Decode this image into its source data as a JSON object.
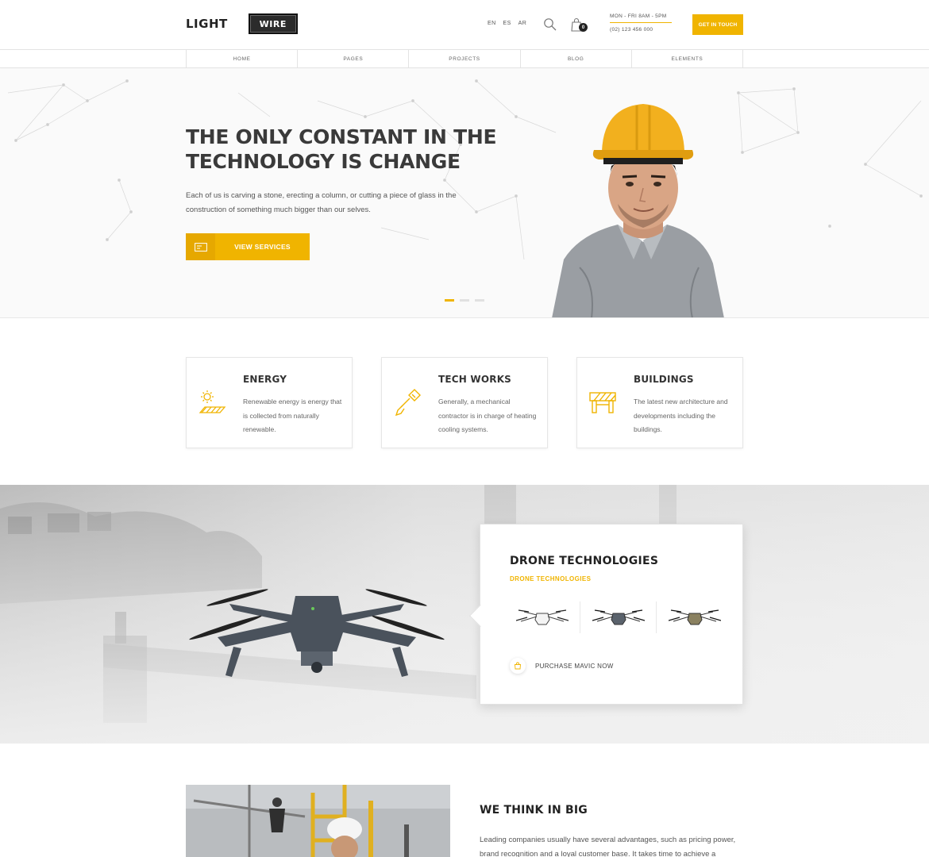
{
  "header": {
    "logo_light": "LIGHT",
    "logo_wire": "WIRE",
    "languages": [
      "EN",
      "ES",
      "AR"
    ],
    "cart_count": "0",
    "hours": "MON - FRI 8AM - 5PM",
    "phone": "(02) 123 456 000",
    "cta_label": "GET IN TOUCH",
    "icons": [
      "search-icon",
      "cart-icon"
    ]
  },
  "nav": {
    "items": [
      "HOME",
      "PAGES",
      "PROJECTS",
      "BLOG",
      "ELEMENTS"
    ]
  },
  "hero": {
    "title": "THE ONLY CONSTANT IN THE TECHNOLOGY IS CHANGE",
    "text": "Each of us is carving a stone, erecting a column, or cutting a piece of glass in the construction of something much bigger than our selves.",
    "button_label": "VIEW SERVICES",
    "slides": 3,
    "active_slide": 1
  },
  "features": [
    {
      "title": "ENERGY",
      "text": "Renewable energy is energy that is collected from naturally renewable.",
      "icon": "solar-icon"
    },
    {
      "title": "TECH WORKS",
      "text": "Generally, a mechanical contractor is in charge of heating cooling systems.",
      "icon": "screwdriver-icon"
    },
    {
      "title": "BUILDINGS",
      "text": "The latest new architecture and developments including the buildings.",
      "icon": "barrier-icon"
    }
  ],
  "drone": {
    "title": "DRONE TECHNOLOGIES",
    "subtitle": "DRONE TECHNOLOGIES",
    "models": [
      "drone-white",
      "drone-grey",
      "drone-olive"
    ],
    "purchase_label": "PURCHASE MAVIC NOW"
  },
  "think": {
    "title": "WE THINK IN BIG",
    "text": "Leading companies usually have several advantages, such as pricing power, brand recognition and a loyal customer base. It takes time to achieve a"
  },
  "colors": {
    "accent": "#f0b400",
    "dark": "#2b2b2b"
  }
}
